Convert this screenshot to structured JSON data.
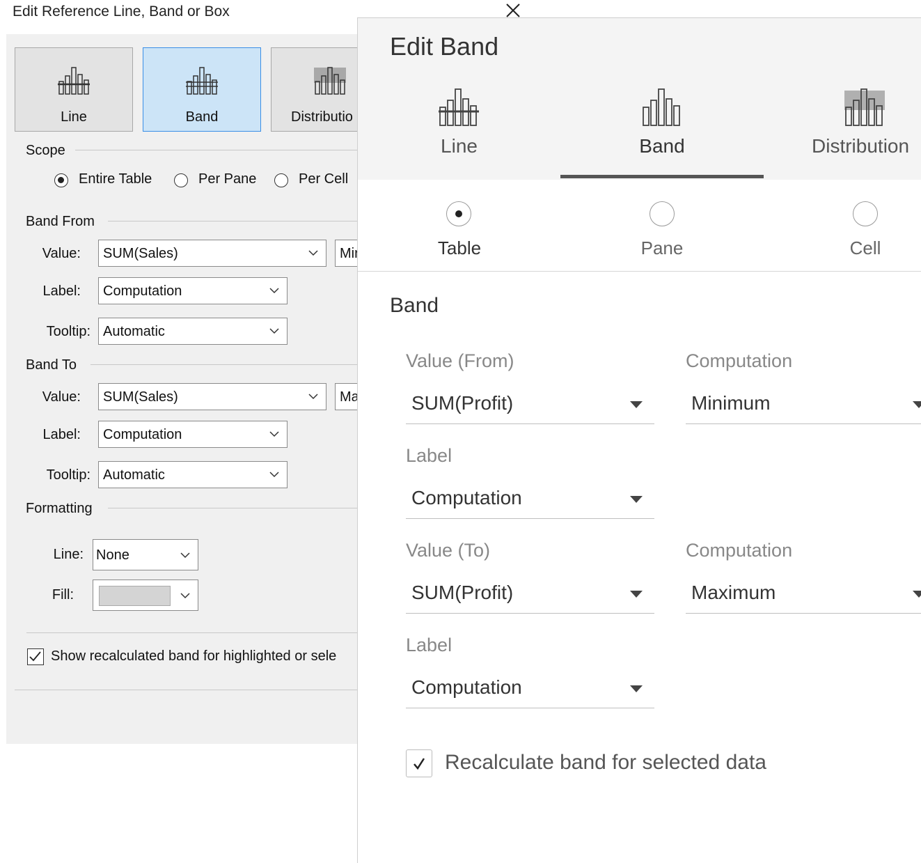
{
  "legacy_dialog": {
    "title": "Edit Reference Line, Band or Box",
    "type_buttons": [
      {
        "label": "Line",
        "icon": "reference-line-icon",
        "selected": false
      },
      {
        "label": "Band",
        "icon": "reference-band-icon",
        "selected": true
      },
      {
        "label": "Distributio",
        "icon": "distribution-icon",
        "selected": false
      }
    ],
    "scope": {
      "group_label": "Scope",
      "options": [
        "Entire Table",
        "Per Pane",
        "Per Cell"
      ],
      "selected": "Entire Table"
    },
    "band_from": {
      "group_label": "Band From",
      "value_label": "Value:",
      "value": "SUM(Sales)",
      "aggregation_partial": "Mir",
      "label_label": "Label:",
      "label_value": "Computation",
      "tooltip_label": "Tooltip:",
      "tooltip_value": "Automatic"
    },
    "band_to": {
      "group_label": "Band To",
      "value_label": "Value:",
      "value": "SUM(Sales)",
      "aggregation_partial": "Ma",
      "label_label": "Label:",
      "label_value": "Computation",
      "tooltip_label": "Tooltip:",
      "tooltip_value": "Automatic"
    },
    "formatting": {
      "group_label": "Formatting",
      "line_label": "Line:",
      "line_value": "None",
      "fill_label": "Fill:",
      "fill_color": "#d4d4d4"
    },
    "recalc_checkbox": {
      "label": "Show recalculated band for highlighted or sele",
      "checked": true
    }
  },
  "panel": {
    "title": "Edit Band",
    "close_icon": "close-icon",
    "tabs": [
      {
        "label": "Line",
        "icon": "reference-line-icon",
        "selected": false
      },
      {
        "label": "Band",
        "icon": "reference-band-icon",
        "selected": true
      },
      {
        "label": "Distribution",
        "icon": "distribution-icon",
        "selected": false
      }
    ],
    "scope_options": [
      {
        "label": "Table",
        "selected": true
      },
      {
        "label": "Pane",
        "selected": false
      },
      {
        "label": "Cell",
        "selected": false
      }
    ],
    "section_title": "Band",
    "value_from": {
      "caption": "Value (From)",
      "value": "SUM(Profit)"
    },
    "computation_from": {
      "caption": "Computation",
      "value": "Minimum"
    },
    "label_from": {
      "caption": "Label",
      "value": "Computation"
    },
    "value_to": {
      "caption": "Value (To)",
      "value": "SUM(Profit)"
    },
    "computation_to": {
      "caption": "Computation",
      "value": "Maximum"
    },
    "label_to": {
      "caption": "Label",
      "value": "Computation"
    },
    "recalc_checkbox": {
      "label": "Recalculate band for selected data",
      "checked": true
    }
  }
}
